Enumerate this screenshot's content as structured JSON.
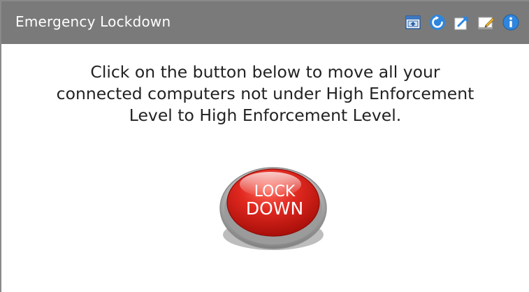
{
  "widget": {
    "title": "Emergency Lockdown",
    "toolbar": {
      "icons": [
        "dock-icon",
        "refresh-icon",
        "popout-icon",
        "edit-icon",
        "info-icon"
      ]
    }
  },
  "main": {
    "message_lines": [
      "Click on the button below to move all your",
      "connected computers not under High Enforcement",
      "Level to High Enforcement Level."
    ],
    "lockdown_button": {
      "line1": "LOCK",
      "line2": "DOWN"
    }
  },
  "colors": {
    "titlebar": "#7a7a7a",
    "button_red": "#d9231d",
    "icon_blue": "#2e86de"
  }
}
